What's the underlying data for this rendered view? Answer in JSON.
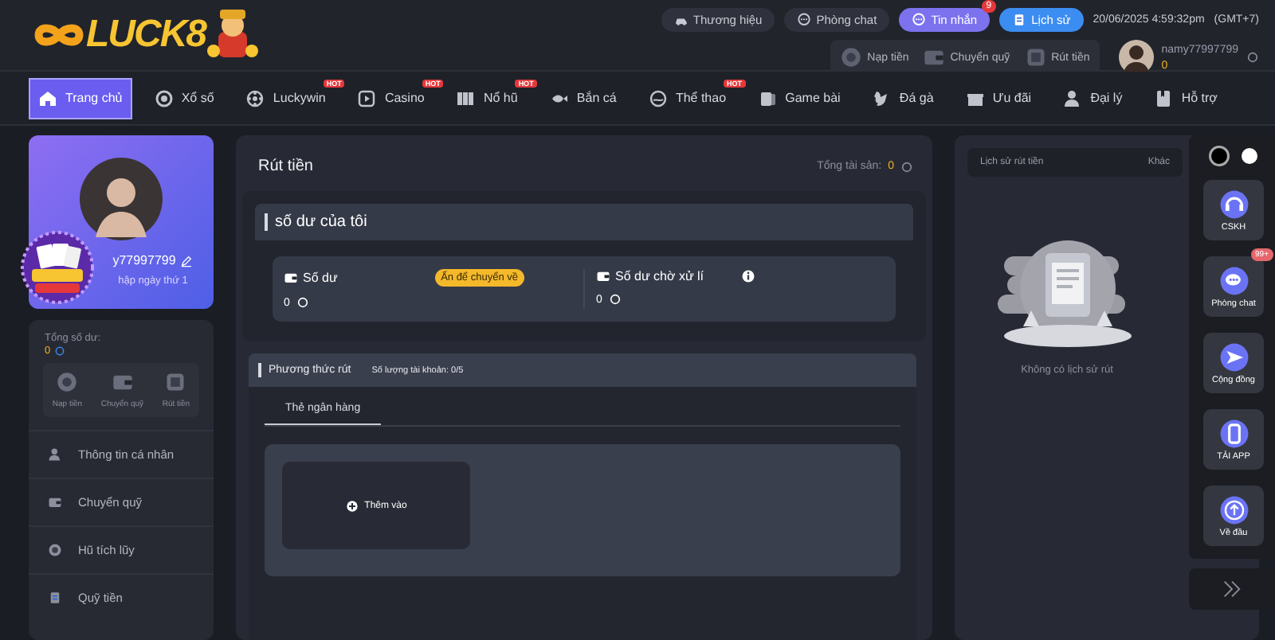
{
  "header": {
    "logo": "LUCK8",
    "top_buttons": [
      {
        "kind": "plain",
        "label": "Thương hiệu"
      },
      {
        "kind": "plain",
        "label": "Phòng chat"
      },
      {
        "kind": "purple",
        "label": "Tin nhắn",
        "badge": "9"
      },
      {
        "kind": "blue",
        "label": "Lịch sử"
      }
    ],
    "datetime": "20/06/2025 4:59:32pm",
    "timezone": "(GMT+7)",
    "wallet_actions": [
      "Nạp tiền",
      "Chuyển quỹ",
      "Rút tiền"
    ],
    "user": {
      "name": "namy77997799",
      "balance": "0"
    }
  },
  "nav": {
    "items": [
      {
        "label": "Trang chủ",
        "selected": true
      },
      {
        "label": "Xổ số",
        "selected": false
      },
      {
        "label": "Luckywin",
        "selected": false,
        "badge": "HOT"
      },
      {
        "label": "Casino",
        "selected": false,
        "badge": "HOT"
      },
      {
        "label": "Nổ hũ",
        "selected": false,
        "badge": "HOT"
      },
      {
        "label": "Bắn cá",
        "selected": false
      },
      {
        "label": "Thể thao",
        "selected": false,
        "badge": "HOT"
      },
      {
        "label": "Game bài",
        "selected": false
      },
      {
        "label": "Đá gà",
        "selected": false
      },
      {
        "label": "Ưu đãi",
        "selected": false
      },
      {
        "label": "Đại lý",
        "selected": false
      },
      {
        "label": "Hỗ trợ",
        "selected": false
      }
    ]
  },
  "sidebar": {
    "profile": {
      "username": "y77997799",
      "login_note": "hập ngày thứ 1"
    },
    "balance_label": "Tổng số dư:",
    "balance": "0",
    "actions": [
      "Nạp tiền",
      "Chuyển quỹ",
      "Rút tiền"
    ],
    "menu": [
      "Thông tin cá nhân",
      "Chuyển quỹ",
      "Hũ tích lũy",
      "Quỹ tiền"
    ]
  },
  "main": {
    "title": "Rút tiền",
    "total_label": "Tổng tài sản:",
    "total": "0",
    "balance_title": "số dư của tôi",
    "balances": [
      {
        "kind": "transfer",
        "label": "Số dư",
        "value": "0",
        "action": "Ấn để chuyển về"
      },
      {
        "kind": "info",
        "label": "Số dư chờ xử lí",
        "value": "0"
      }
    ],
    "methods": {
      "title": "Phương thức rút",
      "count_label": "Số lượng tài khoản:",
      "count": "0/5",
      "tabs": [
        {
          "label": "Thẻ ngân hàng",
          "selected": true
        }
      ],
      "add_button": "Thêm vào"
    }
  },
  "history": {
    "title": "Lịch sử rút tiền",
    "more": "Khác",
    "empty_text": "Không có lịch sử rút"
  },
  "toolbar": {
    "themes": [
      {
        "kind": "dark",
        "selected": true
      },
      {
        "kind": "light",
        "selected": false
      }
    ],
    "items": [
      {
        "label": "CSKH"
      },
      {
        "label": "Phòng chat",
        "badge": "99+"
      },
      {
        "label": "Cộng đồng"
      },
      {
        "label": "TẢI APP"
      },
      {
        "label": "Về đầu"
      }
    ]
  }
}
